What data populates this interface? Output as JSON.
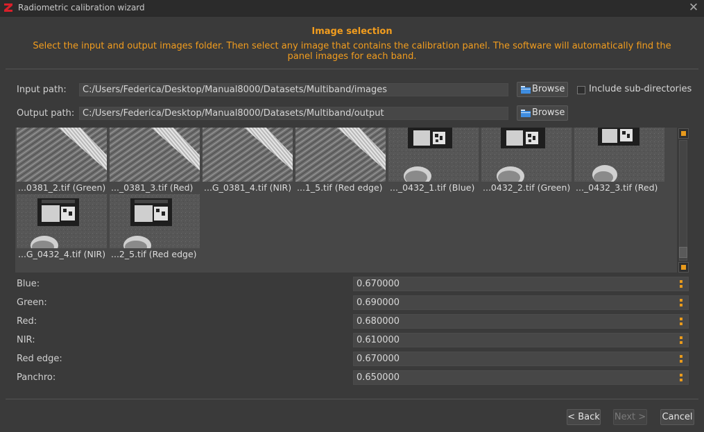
{
  "window": {
    "title": "Radiometric calibration wizard"
  },
  "section": {
    "heading": "Image selection",
    "instructions": "Select the input and output images folder. Then select any image that contains the calibration panel. The software will automatically find the panel images for each band."
  },
  "paths": {
    "input_label": "Input path:",
    "input_value": "C:/Users/Federica/Desktop/Manual8000/Datasets/Multiband/images",
    "output_label": "Output path:",
    "output_value": "C:/Users/Federica/Desktop/Manual8000/Datasets/Multiband/output",
    "browse_label": "Browse",
    "include_subdirs_label": "Include sub-directories",
    "include_subdirs_checked": false
  },
  "thumbnails": [
    {
      "caption": "...0381_2.tif (Green)",
      "kind": "field"
    },
    {
      "caption": "..._0381_3.tif (Red)",
      "kind": "field"
    },
    {
      "caption": "...G_0381_4.tif (NIR)",
      "kind": "field"
    },
    {
      "caption": "...1_5.tif (Red edge)",
      "kind": "field"
    },
    {
      "caption": "..._0432_1.tif (Blue)",
      "kind": "panel"
    },
    {
      "caption": "...0432_2.tif (Green)",
      "kind": "panel"
    },
    {
      "caption": "..._0432_3.tif (Red)",
      "kind": "panel"
    },
    {
      "caption": "...G_0432_4.tif (NIR)",
      "kind": "panel"
    },
    {
      "caption": "...2_5.tif (Red edge)",
      "kind": "panel"
    }
  ],
  "bands": [
    {
      "label": "Blue:",
      "value": "0.670000"
    },
    {
      "label": "Green:",
      "value": "0.690000"
    },
    {
      "label": "Red:",
      "value": "0.680000"
    },
    {
      "label": "NIR:",
      "value": "0.610000"
    },
    {
      "label": "Red edge:",
      "value": "0.670000"
    },
    {
      "label": "Panchro:",
      "value": "0.650000"
    }
  ],
  "footer": {
    "back_label": "< Back",
    "next_label": "Next >",
    "cancel_label": "Cancel"
  },
  "colors": {
    "accent": "#f29d1e",
    "background": "#3a3a3a",
    "field": "#474747"
  }
}
